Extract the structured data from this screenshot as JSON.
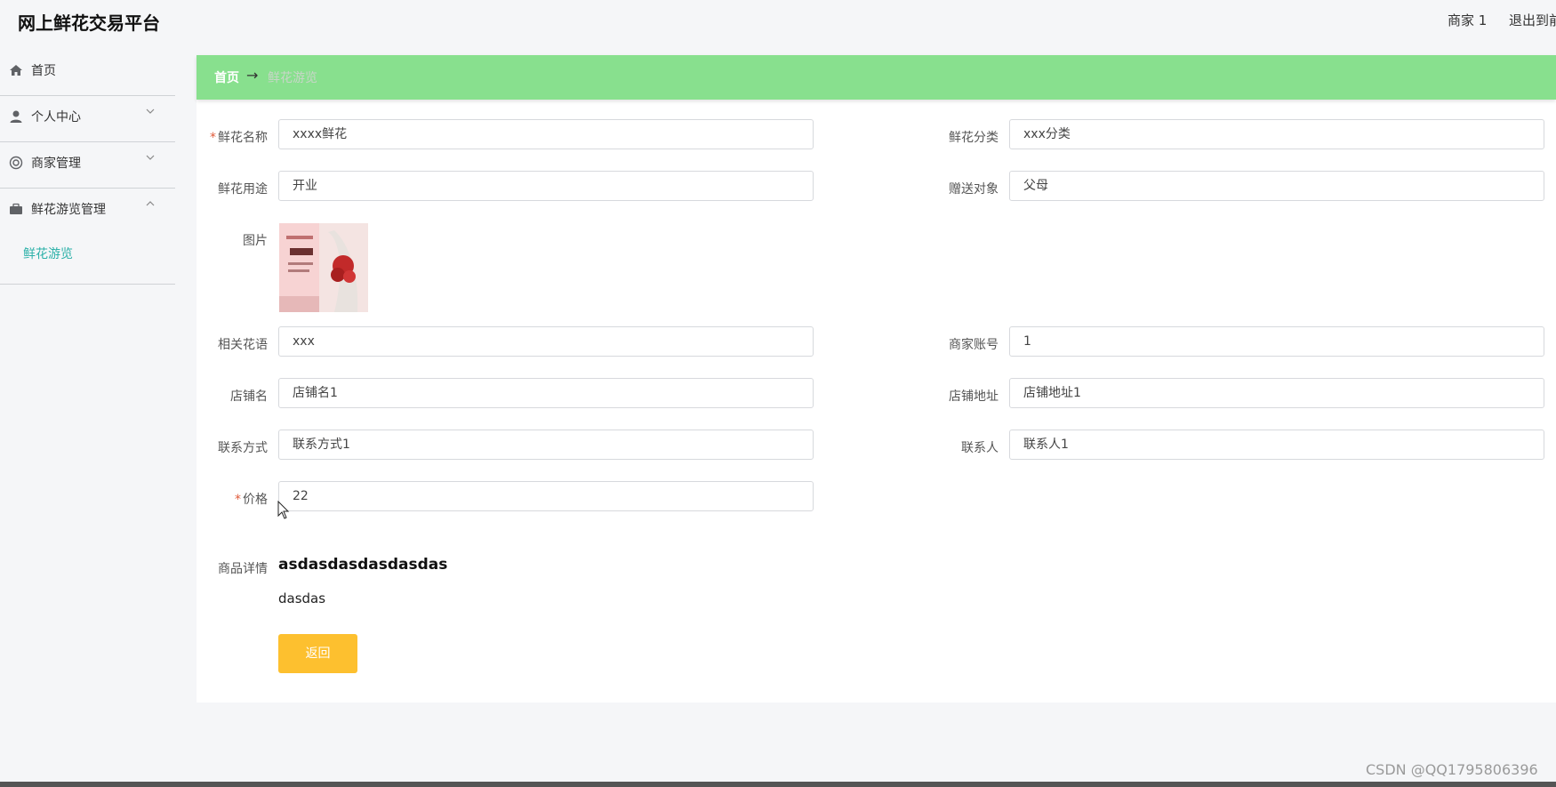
{
  "header": {
    "app_title": "网上鲜花交易平台",
    "user_label": "商家 1",
    "logout_label": "退出到前"
  },
  "sidebar": {
    "items": [
      {
        "label": "首页",
        "icon": "home-icon"
      },
      {
        "label": "个人中心",
        "icon": "user-icon"
      },
      {
        "label": "商家管理",
        "icon": "lifebuoy-icon"
      },
      {
        "label": "鲜花游览管理",
        "icon": "briefcase-icon"
      }
    ],
    "sub_item": "鲜花游览"
  },
  "breadcrumb": {
    "home": "首页",
    "arrow": "→",
    "current": "鲜花游览"
  },
  "form": {
    "flower_name": {
      "label": "鲜花名称",
      "value": "xxxx鲜花",
      "required": "*"
    },
    "category": {
      "label": "鲜花分类",
      "value": "xxx分类"
    },
    "usage": {
      "label": "鲜花用途",
      "value": "开业"
    },
    "recipient": {
      "label": "赠送对象",
      "value": "父母"
    },
    "image": {
      "label": "图片"
    },
    "flower_language": {
      "label": "相关花语",
      "value": "xxx"
    },
    "merchant_account": {
      "label": "商家账号",
      "value": "1"
    },
    "shop_name": {
      "label": "店铺名",
      "value": "店铺名1"
    },
    "shop_address": {
      "label": "店铺地址",
      "value": "店铺地址1"
    },
    "contact_method": {
      "label": "联系方式",
      "value": "联系方式1"
    },
    "contact_person": {
      "label": "联系人",
      "value": "联系人1"
    },
    "price": {
      "label": "价格",
      "value": "22",
      "required": "*"
    },
    "details": {
      "label": "商品详情",
      "heading": "asdasdasdasdasdas",
      "text": "dasdas"
    }
  },
  "actions": {
    "back_label": "返回"
  },
  "watermark": "CSDN @QQ1795806396",
  "colors": {
    "breadcrumb_bg": "#88e08e",
    "accent_teal": "#2bb0a8",
    "button_yellow": "#fdc02f",
    "required_red": "#e05a3a"
  }
}
